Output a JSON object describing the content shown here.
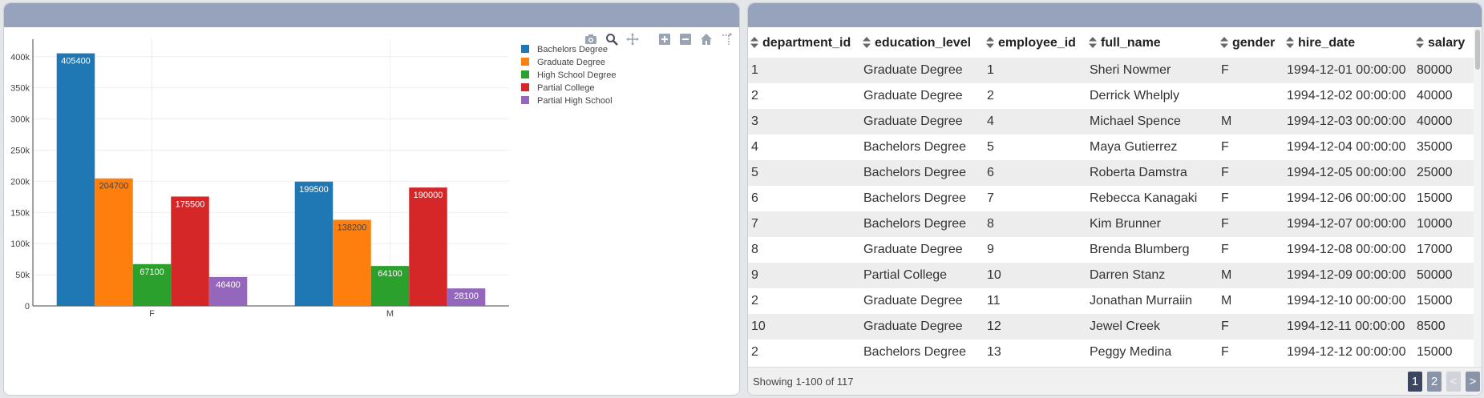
{
  "chart_data": {
    "type": "bar",
    "categories": [
      "F",
      "M"
    ],
    "series": [
      {
        "name": "Bachelors Degree",
        "values": [
          405400,
          199500
        ],
        "color": "#1f77b4",
        "label_color": "#ffffff"
      },
      {
        "name": "Graduate Degree",
        "values": [
          204700,
          138200
        ],
        "color": "#ff7f0e",
        "label_color": "#444444"
      },
      {
        "name": "High School Degree",
        "values": [
          67100,
          64100
        ],
        "color": "#2ca02c",
        "label_color": "#ffffff"
      },
      {
        "name": "Partial College",
        "values": [
          175500,
          190000
        ],
        "color": "#d62728",
        "label_color": "#ffffff"
      },
      {
        "name": "Partial High School",
        "values": [
          46400,
          28100
        ],
        "color": "#9467bd",
        "label_color": "#ffffff"
      }
    ],
    "yticks": [
      0,
      50000,
      100000,
      150000,
      200000,
      250000,
      300000,
      350000,
      400000
    ],
    "ytick_labels": [
      "0",
      "50k",
      "100k",
      "150k",
      "200k",
      "250k",
      "300k",
      "350k",
      "400k"
    ],
    "ylim": [
      0,
      428000
    ],
    "grid": true,
    "legend_position": "top-right",
    "title": "",
    "xlabel": "",
    "ylabel": ""
  },
  "modebar": {
    "icons": [
      "camera-icon",
      "zoom-icon",
      "pan-icon",
      "zoom-in-icon",
      "zoom-out-icon",
      "home-icon",
      "spike-lines-icon"
    ]
  },
  "table": {
    "columns": [
      "department_id",
      "education_level",
      "employee_id",
      "full_name",
      "gender",
      "hire_date",
      "salary"
    ],
    "rows": [
      [
        "1",
        "Graduate Degree",
        "1",
        "Sheri Nowmer",
        "F",
        "1994-12-01 00:00:00",
        "80000"
      ],
      [
        "2",
        "Graduate Degree",
        "2",
        "Derrick Whelply",
        "",
        "1994-12-02 00:00:00",
        "40000"
      ],
      [
        "3",
        "Graduate Degree",
        "4",
        "Michael Spence",
        "M",
        "1994-12-03 00:00:00",
        "40000"
      ],
      [
        "4",
        "Bachelors Degree",
        "5",
        "Maya Gutierrez",
        "F",
        "1994-12-04 00:00:00",
        "35000"
      ],
      [
        "5",
        "Bachelors Degree",
        "6",
        "Roberta Damstra",
        "F",
        "1994-12-05 00:00:00",
        "25000"
      ],
      [
        "6",
        "Bachelors Degree",
        "7",
        "Rebecca Kanagaki",
        "F",
        "1994-12-06 00:00:00",
        "15000"
      ],
      [
        "7",
        "Bachelors Degree",
        "8",
        "Kim Brunner",
        "F",
        "1994-12-07 00:00:00",
        "10000"
      ],
      [
        "8",
        "Graduate Degree",
        "9",
        "Brenda Blumberg",
        "F",
        "1994-12-08 00:00:00",
        "17000"
      ],
      [
        "9",
        "Partial College",
        "10",
        "Darren Stanz",
        "M",
        "1994-12-09 00:00:00",
        "50000"
      ],
      [
        "2",
        "Graduate Degree",
        "11",
        "Jonathan Murraiin",
        "M",
        "1994-12-10 00:00:00",
        "15000"
      ],
      [
        "10",
        "Graduate Degree",
        "12",
        "Jewel Creek",
        "F",
        "1994-12-11 00:00:00",
        "8500"
      ],
      [
        "2",
        "Bachelors Degree",
        "13",
        "Peggy Medina",
        "F",
        "1994-12-12 00:00:00",
        "15000"
      ]
    ],
    "status": "Showing 1-100 of 117",
    "pages": [
      "1",
      "2"
    ],
    "prev_label": "<",
    "next_label": ">"
  }
}
